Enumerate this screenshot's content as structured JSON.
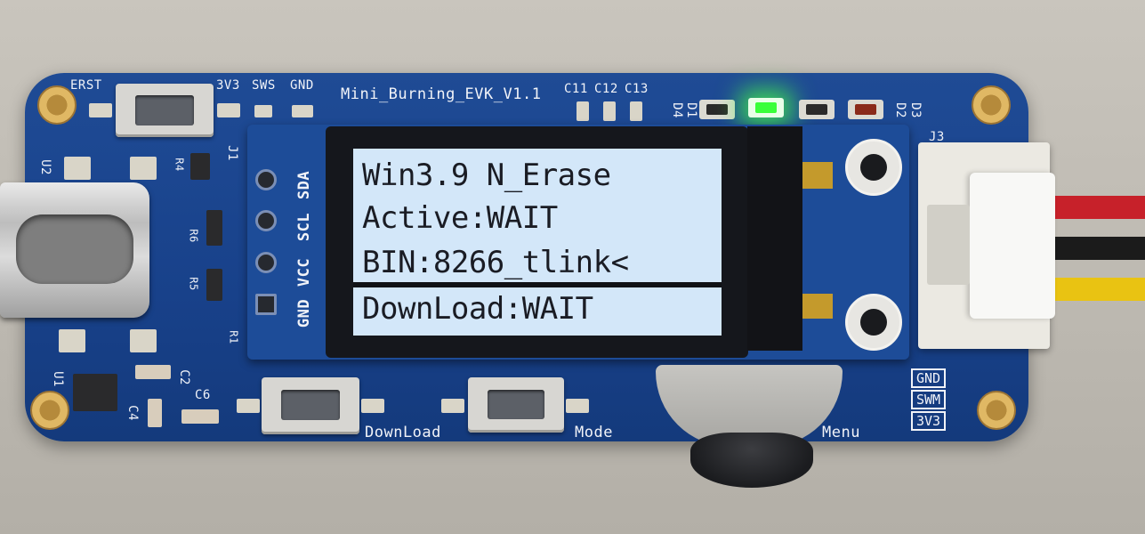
{
  "board": {
    "title": "Mini_Burning_EVK_V1.1",
    "top_labels": [
      "ERST",
      "3V3",
      "SWS",
      "GND"
    ],
    "cap_labels": [
      "C11",
      "C12",
      "C13"
    ],
    "led_labels": [
      "D4",
      "D1",
      "D2",
      "D3"
    ],
    "connector_label": "J3",
    "header_labels": [
      "GND",
      "VCC",
      "SCL",
      "SDA"
    ],
    "component_labels": [
      "U2",
      "R4",
      "J1",
      "R6",
      "R5",
      "U1",
      "C4",
      "C2",
      "C6",
      "R1"
    ],
    "button_labels": [
      "DownLoad",
      "Mode",
      "Menu"
    ],
    "side_box_labels": [
      "GND",
      "SWM",
      "3V3"
    ]
  },
  "oled": {
    "lines": [
      "Win3.9 N_Erase",
      "Active:WAIT",
      "BIN:8266_tlink<",
      "DownLoad:WAIT"
    ],
    "selected_line": 2
  },
  "colors": {
    "pcb": "#1d4c98",
    "oled_background": "#d3e7f9",
    "led_active": "#39ff3a",
    "wire_red": "#c7212a",
    "wire_black": "#1b1b1b",
    "wire_yellow": "#e9c312"
  }
}
